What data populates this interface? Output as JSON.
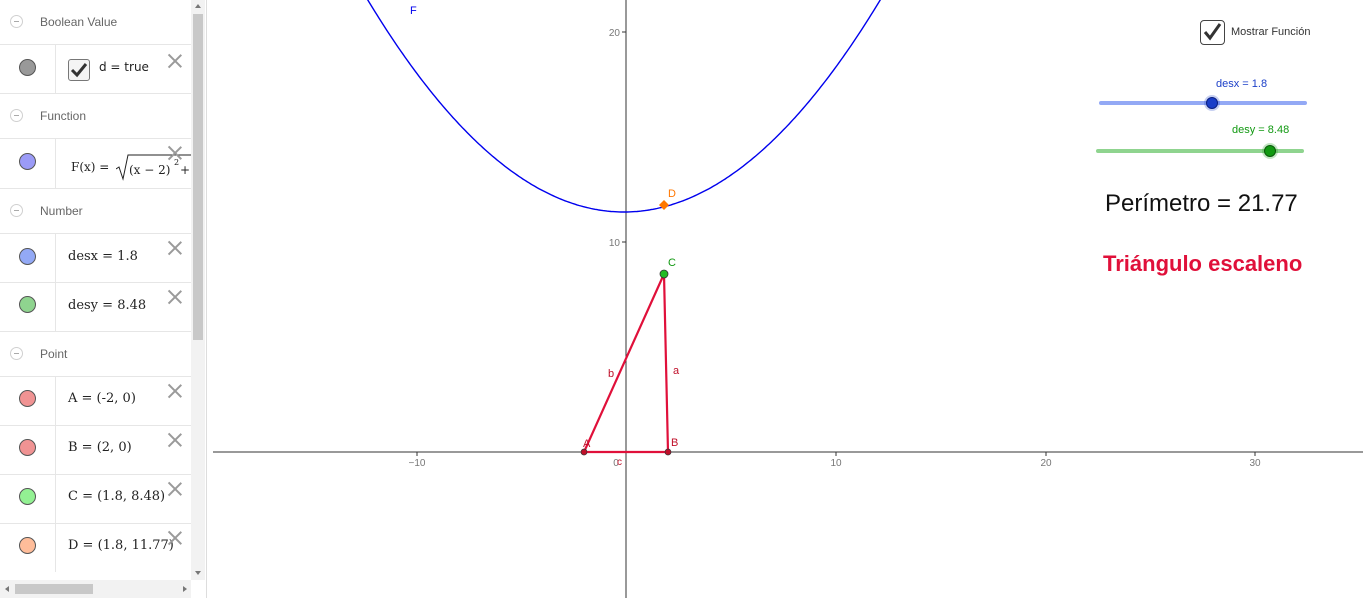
{
  "algebra": {
    "groups": {
      "boolean": "Boolean Value",
      "function": "Function",
      "number": "Number",
      "point": "Point"
    },
    "items": {
      "d": {
        "label": "d = true",
        "color": "#999999"
      },
      "F": {
        "label": "F(x) = ",
        "color": "#9b9bf7"
      },
      "desx": {
        "label": "desx = 1.8",
        "color": "#93a9f5"
      },
      "desy": {
        "label": "desy = 8.48",
        "color": "#8fd48f"
      },
      "A": {
        "label": "A = (-2, 0)",
        "color": "#f09393"
      },
      "B": {
        "label": "B = (2, 0)",
        "color": "#f09393"
      },
      "C": {
        "label": "C = (1.8, 8.48)",
        "color": "#93f193"
      },
      "D": {
        "label": "D = (1.8, 11.77)",
        "color": "#ffbd9a"
      }
    }
  },
  "graphics": {
    "x_ticks": [
      "−10",
      "0",
      "10",
      "20",
      "30"
    ],
    "y_ticks": [
      "20",
      "10"
    ],
    "curve_label": "F",
    "point_labels": {
      "A": "A",
      "B": "B",
      "C": "C",
      "D": "D"
    },
    "segment_labels": {
      "a": "a",
      "b": "b",
      "c": "c"
    },
    "checkbox_label": "Mostrar Función",
    "slider_desx": {
      "label": "desx = 1.8",
      "value": 1.8,
      "color": "#1a3ec8"
    },
    "slider_desy": {
      "label": "desy = 8.48",
      "value": 8.48,
      "color": "#119911"
    },
    "perimeter_text": "Perímetro = 21.77",
    "classification_text": "Triángulo escaleno",
    "colors": {
      "curve": "#0000ee",
      "triangle": "#e0103a",
      "point_D": "#ff7700",
      "classification": "#e0103a"
    }
  }
}
